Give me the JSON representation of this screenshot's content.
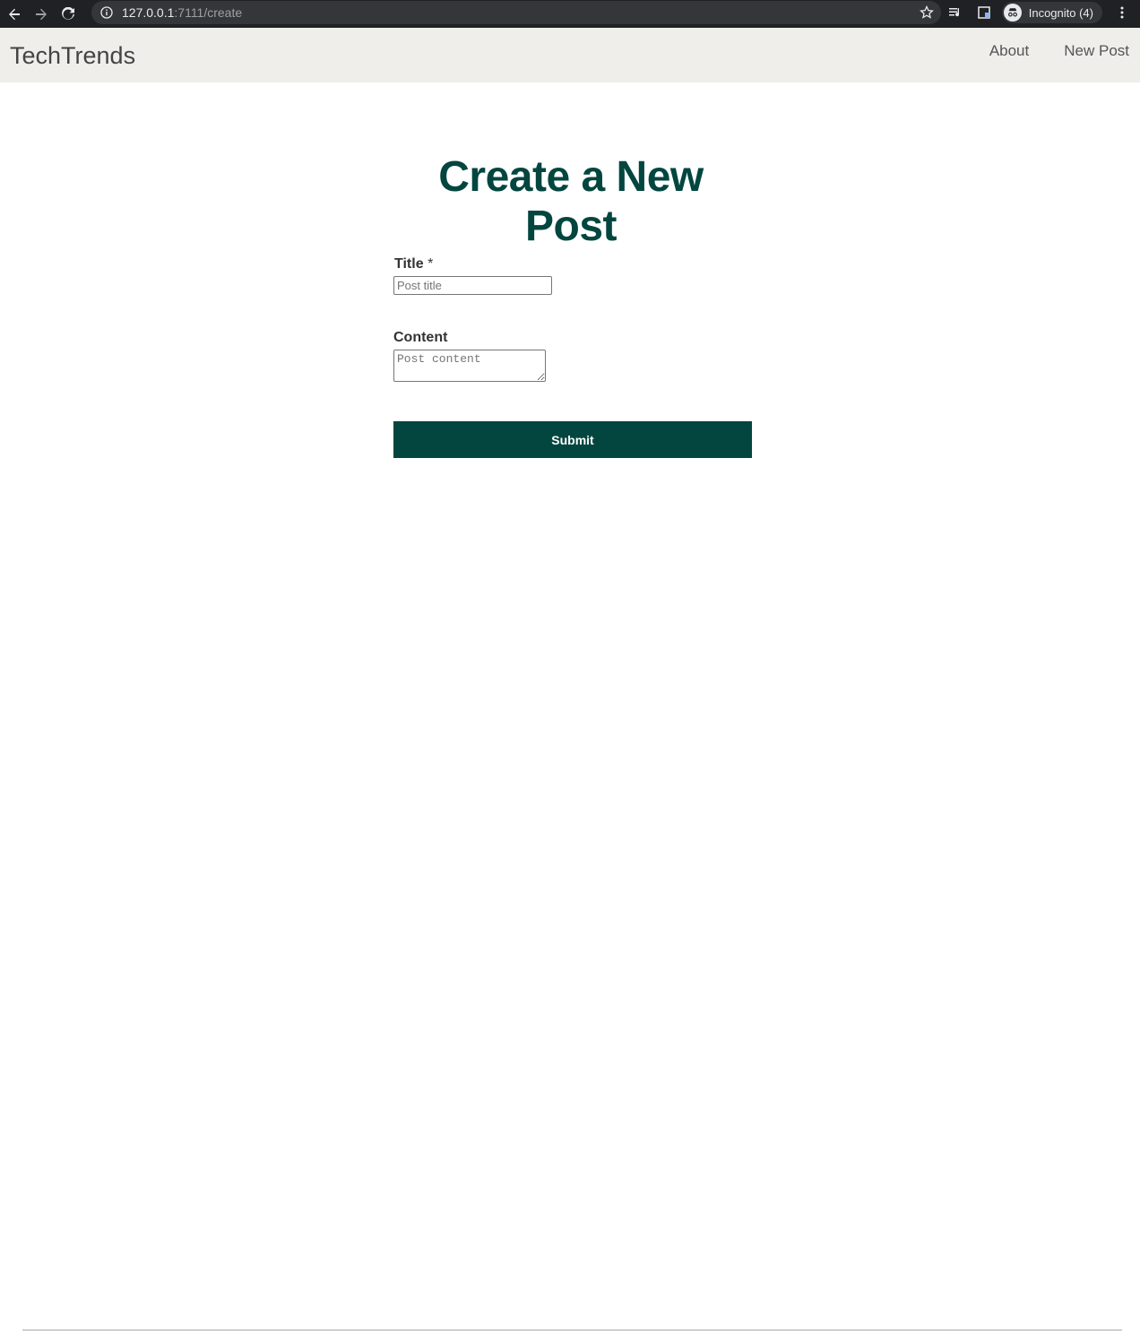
{
  "browser": {
    "url_host": "127.0.0.1",
    "url_path": ":7111/create",
    "profile_label": "Incognito (4)"
  },
  "site": {
    "brand": "TechTrends",
    "nav": {
      "about": "About",
      "new_post": "New Post"
    }
  },
  "form": {
    "heading": "Create a New Post",
    "title_label": "Title",
    "title_required_mark": "*",
    "title_placeholder": "Post title",
    "title_value": "",
    "content_label": "Content",
    "content_placeholder": "Post content",
    "content_value": "",
    "submit_label": "Submit"
  },
  "colors": {
    "accent": "#03463f",
    "navbar_bg": "#efeeeb",
    "chrome_bg": "#202124"
  }
}
